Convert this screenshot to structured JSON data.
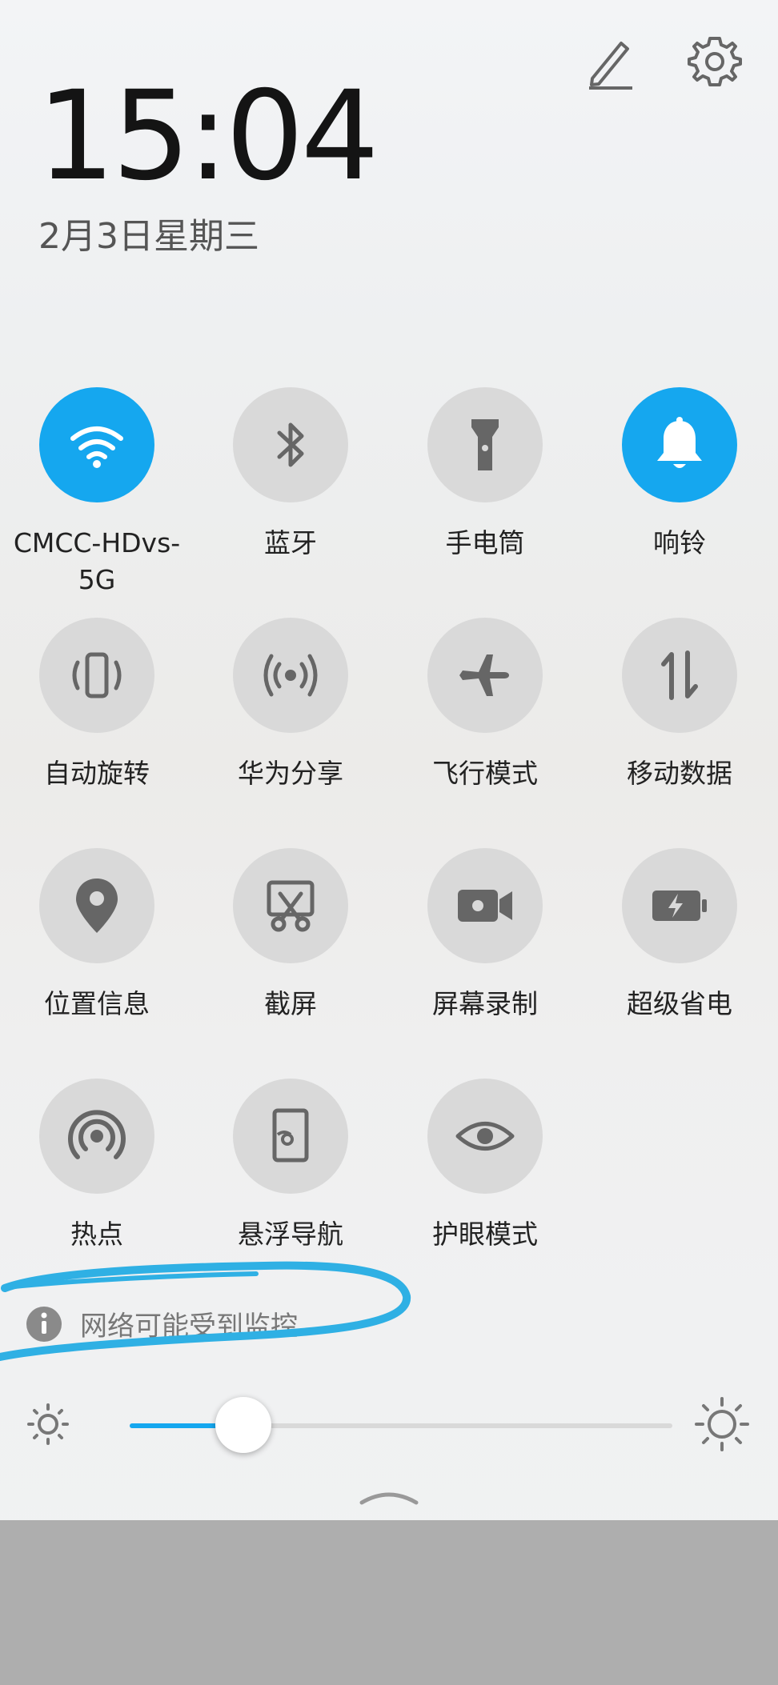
{
  "clock": {
    "time": "15:04",
    "date": "2月3日星期三"
  },
  "header": {
    "edit_icon": "pencil-icon",
    "settings_icon": "gear-icon"
  },
  "tiles": [
    {
      "label": "CMCC-HDvs-5G",
      "icon": "wifi-icon",
      "active": true
    },
    {
      "label": "蓝牙",
      "icon": "bluetooth-icon",
      "active": false
    },
    {
      "label": "手电筒",
      "icon": "flashlight-icon",
      "active": false
    },
    {
      "label": "响铃",
      "icon": "bell-icon",
      "active": true
    },
    {
      "label": "自动旋转",
      "icon": "auto-rotate-icon",
      "active": false
    },
    {
      "label": "华为分享",
      "icon": "share-icon",
      "active": false
    },
    {
      "label": "飞行模式",
      "icon": "airplane-icon",
      "active": false
    },
    {
      "label": "移动数据",
      "icon": "mobile-data-icon",
      "active": false
    },
    {
      "label": "位置信息",
      "icon": "location-icon",
      "active": false
    },
    {
      "label": "截屏",
      "icon": "screenshot-icon",
      "active": false
    },
    {
      "label": "屏幕录制",
      "icon": "screen-record-icon",
      "active": false
    },
    {
      "label": "超级省电",
      "icon": "battery-saver-icon",
      "active": false
    },
    {
      "label": "热点",
      "icon": "hotspot-icon",
      "active": false
    },
    {
      "label": "悬浮导航",
      "icon": "floating-nav-icon",
      "active": false
    },
    {
      "label": "护眼模式",
      "icon": "eye-comfort-icon",
      "active": false
    }
  ],
  "notice": {
    "text": "网络可能受到监控",
    "icon": "info-icon"
  },
  "brightness": {
    "level": 0.21
  },
  "colors": {
    "accent": "#15a7ef",
    "tile_inactive": "#d9d9d9",
    "annotation": "#2fb0e4"
  }
}
